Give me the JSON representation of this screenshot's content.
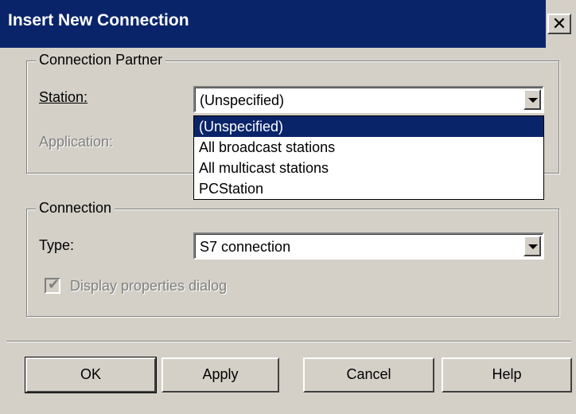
{
  "dialog": {
    "title": "Insert New Connection",
    "close_symbol": "✕"
  },
  "connection_partner": {
    "group_label": "Connection Partner",
    "station_label": "Station:",
    "station_value": "(Unspecified)",
    "application_label": "Application:",
    "dropdown_items": [
      "(Unspecified)",
      "All broadcast stations",
      "All multicast stations",
      "PCStation"
    ],
    "dropdown_selected_index": 0
  },
  "connection": {
    "group_label": "Connection",
    "type_label": "Type:",
    "type_value": "S7 connection",
    "display_properties_label": "Display properties dialog",
    "display_properties_checked": true,
    "display_properties_enabled": false
  },
  "buttons": {
    "ok": "OK",
    "apply": "Apply",
    "cancel": "Cancel",
    "help": "Help"
  },
  "colors": {
    "title_bar": "#0a246a",
    "face": "#d4d0c8",
    "selection": "#0a246a"
  }
}
